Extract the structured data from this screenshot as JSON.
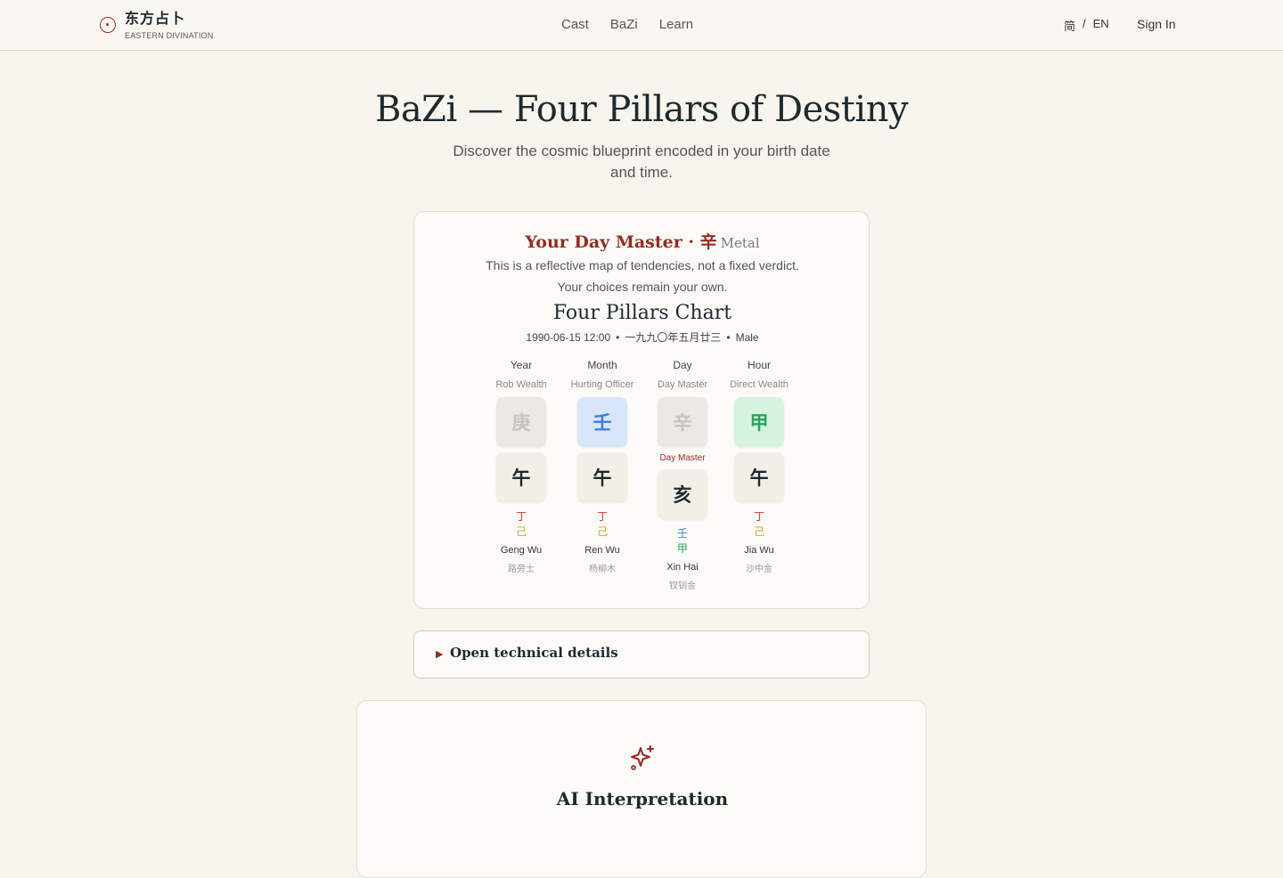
{
  "header": {
    "brand_name": "东方占卜",
    "brand_sub": "EASTERN DIVINATION",
    "nav": [
      "Cast",
      "BaZi",
      "Learn"
    ],
    "lang_zh": "简",
    "lang_sep": "/",
    "lang_en": "EN",
    "sign_in": "Sign In"
  },
  "hero": {
    "title": "BaZi — Four Pillars of Destiny",
    "subtitle": "Discover the cosmic blueprint encoded in your birth date and time."
  },
  "chart_card": {
    "day_master_title": "Your Day Master · 辛",
    "day_master_element": "Metal",
    "note_line1": "This is a reflective map of tendencies, not a fixed verdict.",
    "note_line2": "Your choices remain your own.",
    "chart_title": "Four Pillars Chart",
    "meta_date": "1990-06-15 12:00",
    "meta_lunar": "一九九〇年五月廿三",
    "meta_gender": "Male",
    "meta_dot": "•",
    "pillars": [
      {
        "label": "Year",
        "god": "Rob Wealth",
        "stem": "庚",
        "branch": "午",
        "hidden": [
          {
            "c": "丁",
            "color": "#d9342b"
          },
          {
            "c": "己",
            "color": "#d9a020"
          }
        ],
        "pinyin": "Geng Wu",
        "nayin": "路旁土",
        "stem_bg": "#ece8e3",
        "stem_fg": "#c8c3bd",
        "day_master": false
      },
      {
        "label": "Month",
        "god": "Hurting Officer",
        "stem": "壬",
        "branch": "午",
        "hidden": [
          {
            "c": "丁",
            "color": "#d9342b"
          },
          {
            "c": "己",
            "color": "#d9a020"
          }
        ],
        "pinyin": "Ren Wu",
        "nayin": "杨柳木",
        "stem_bg": "#d8e6fb",
        "stem_fg": "#3a7be0",
        "day_master": false
      },
      {
        "label": "Day",
        "god": "Day Master",
        "stem": "辛",
        "branch": "亥",
        "hidden": [
          {
            "c": "壬",
            "color": "#3a7be0"
          },
          {
            "c": "甲",
            "color": "#22a55b"
          }
        ],
        "pinyin": "Xin Hai",
        "nayin": "钗钏金",
        "stem_bg": "#ece8e3",
        "stem_fg": "#c8c3bd",
        "day_master": true,
        "day_master_tag": "Day Master"
      },
      {
        "label": "Hour",
        "god": "Direct Wealth",
        "stem": "甲",
        "branch": "午",
        "hidden": [
          {
            "c": "丁",
            "color": "#d9342b"
          },
          {
            "c": "己",
            "color": "#d9a020"
          }
        ],
        "pinyin": "Jia Wu",
        "nayin": "沙中金",
        "stem_bg": "#d5f3df",
        "stem_fg": "#22a55b",
        "day_master": false
      }
    ]
  },
  "details": {
    "caret": "▶",
    "label": "Open technical details"
  },
  "ai": {
    "icon": "sparkles-icon",
    "title": "AI Interpretation"
  },
  "colors": {
    "accent": "#9a2a20",
    "background": "#f8f4ee",
    "branch_tile": "#f3efe6"
  }
}
